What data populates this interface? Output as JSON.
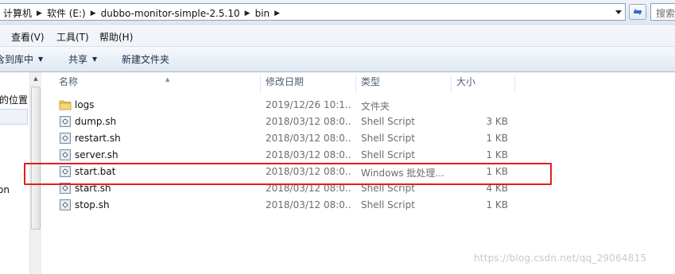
{
  "address_bar": {
    "breadcrumbs": [
      "计算机",
      "软件 (E:)",
      "dubbo-monitor-simple-2.5.10",
      "bin"
    ]
  },
  "search": {
    "placeholder": "搜索"
  },
  "menu": {
    "items": [
      "查看(V)",
      "工具(T)",
      "帮助(H)"
    ]
  },
  "toolbar": {
    "include_library": "含到库中",
    "share": "共享",
    "new_folder": "新建文件夹"
  },
  "nav_pane": {
    "items": [
      "的位置",
      "on"
    ]
  },
  "columns": {
    "name": "名称",
    "modified": "修改日期",
    "type": "类型",
    "size": "大小"
  },
  "files": [
    {
      "name": "logs",
      "modified": "2019/12/26 10:1...",
      "type": "文件夹",
      "size": "",
      "icon": "folder-icon"
    },
    {
      "name": "dump.sh",
      "modified": "2018/03/12 08:0...",
      "type": "Shell Script",
      "size": "3 KB",
      "icon": "script-file-icon"
    },
    {
      "name": "restart.sh",
      "modified": "2018/03/12 08:0...",
      "type": "Shell Script",
      "size": "1 KB",
      "icon": "script-file-icon"
    },
    {
      "name": "server.sh",
      "modified": "2018/03/12 08:0...",
      "type": "Shell Script",
      "size": "1 KB",
      "icon": "script-file-icon"
    },
    {
      "name": "start.bat",
      "modified": "2018/03/12 08:0...",
      "type": "Windows 批处理...",
      "size": "1 KB",
      "icon": "batch-file-icon"
    },
    {
      "name": "start.sh",
      "modified": "2018/03/12 08:0...",
      "type": "Shell Script",
      "size": "4 KB",
      "icon": "script-file-icon"
    },
    {
      "name": "stop.sh",
      "modified": "2018/03/12 08:0...",
      "type": "Shell Script",
      "size": "1 KB",
      "icon": "script-file-icon"
    }
  ],
  "highlight_color": "#e51c1c",
  "watermark": "https://blog.csdn.net/qq_29064815"
}
